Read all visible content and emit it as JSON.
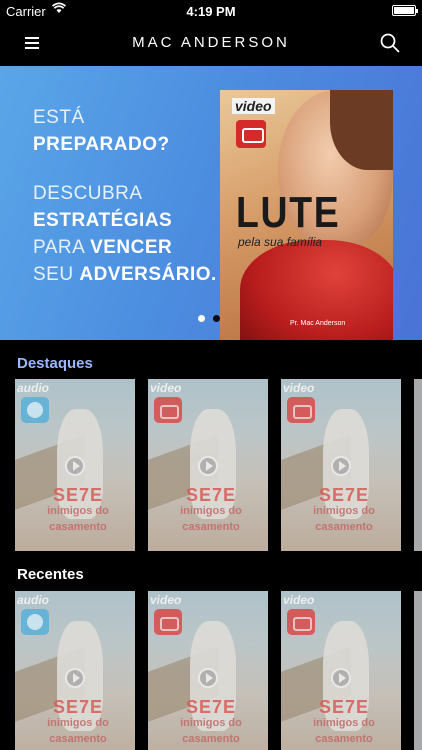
{
  "status_bar": {
    "carrier": "Carrier",
    "time": "4:19 PM"
  },
  "nav": {
    "title": "MAC ANDERSON"
  },
  "banner": {
    "line1": "ESTÁ",
    "line2": "PREPARADO?",
    "line3": "DESCUBRA",
    "line4": "ESTRATÉGIAS",
    "line5a": "PARA ",
    "line5b": "VENCER",
    "line6a": "SEU ",
    "line6b": "ADVERSÁRIO.",
    "poster": {
      "tag": "video",
      "title": "LUTE",
      "subtitle": "pela sua família",
      "author": "Pr. Mac Anderson"
    },
    "slides_total": 2,
    "slide_active": 1
  },
  "sections": {
    "featured": {
      "title": "Destaques"
    },
    "recent": {
      "title": "Recentes"
    }
  },
  "cards": [
    {
      "kind": "audio",
      "tag": "audio",
      "title_big": "SE7E",
      "title_small": "inimigos do casamento"
    },
    {
      "kind": "video",
      "tag": "video",
      "title_big": "SE7E",
      "title_small": "inimigos do casamento"
    },
    {
      "kind": "video",
      "tag": "video",
      "title_big": "SE7E",
      "title_small": "inimigos do casamento"
    }
  ],
  "colors": {
    "accent": "#9bb7ff",
    "banner": "#4c8ee0",
    "background": "#000000"
  }
}
